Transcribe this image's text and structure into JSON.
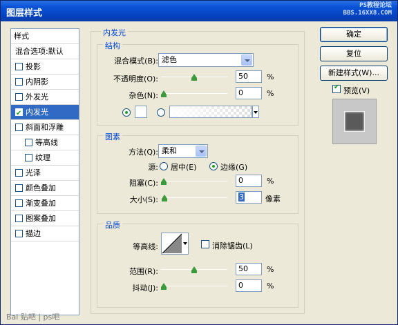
{
  "window": {
    "title": "图层样式",
    "watermark_line1": "PS教程论坛",
    "watermark_line2": "BBS.16XX8.COM"
  },
  "sidebar": {
    "header": "样式",
    "items": [
      {
        "label": "混合选项:默认",
        "checkbox": false
      },
      {
        "label": "投影",
        "checkbox": true,
        "checked": false
      },
      {
        "label": "内阴影",
        "checkbox": true,
        "checked": false
      },
      {
        "label": "外发光",
        "checkbox": true,
        "checked": false
      },
      {
        "label": "内发光",
        "checkbox": true,
        "checked": true,
        "selected": true
      },
      {
        "label": "斜面和浮雕",
        "checkbox": true,
        "checked": false
      },
      {
        "label": "等高线",
        "checkbox": true,
        "checked": false,
        "indent": true
      },
      {
        "label": "纹理",
        "checkbox": true,
        "checked": false,
        "indent": true
      },
      {
        "label": "光泽",
        "checkbox": true,
        "checked": false
      },
      {
        "label": "颜色叠加",
        "checkbox": true,
        "checked": false
      },
      {
        "label": "渐变叠加",
        "checkbox": true,
        "checked": false
      },
      {
        "label": "图案叠加",
        "checkbox": true,
        "checked": false
      },
      {
        "label": "描边",
        "checkbox": true,
        "checked": false
      }
    ]
  },
  "panel": {
    "title": "内发光",
    "structure": {
      "label": "结构",
      "blend_mode_label": "混合模式(B):",
      "blend_mode_value": "滤色",
      "opacity_label": "不透明度(O):",
      "opacity_value": "50",
      "opacity_level": 50,
      "noise_label": "杂色(N):",
      "noise_value": "0",
      "noise_level": 0,
      "unit": "%"
    },
    "elements": {
      "label": "图素",
      "method_label": "方法(Q):",
      "method_value": "柔和",
      "source_label": "源:",
      "source_center": "居中(E)",
      "source_edge": "边缘(G)",
      "choke_label": "阻塞(C):",
      "choke_value": "0",
      "choke_level": 0,
      "size_label": "大小(S):",
      "size_value": "3",
      "size_unit": "像素",
      "size_level": 3,
      "unit": "%"
    },
    "quality": {
      "label": "品质",
      "contour_label": "等高线:",
      "antialias_label": "消除锯齿(L)",
      "range_label": "范围(R):",
      "range_value": "50",
      "range_level": 50,
      "jitter_label": "抖动(J):",
      "jitter_value": "0",
      "jitter_level": 0,
      "unit": "%"
    }
  },
  "buttons": {
    "ok": "确定",
    "reset": "复位",
    "new_style": "新建样式(W)...",
    "preview_label": "预览(V)"
  },
  "footer": {
    "watermark": "Bai 贴吧 | ps吧"
  }
}
